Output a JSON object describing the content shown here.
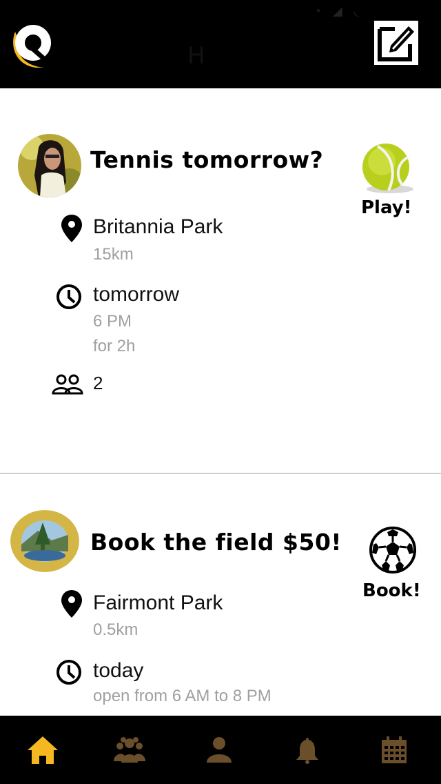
{
  "header": {
    "title": "H",
    "logo_icon": "app-logo-icon",
    "compose_icon": "compose-icon"
  },
  "colors": {
    "header_bg": "#000000",
    "accent": "#f5b820",
    "tab_inactive": "#6b4f2a",
    "secondary_text": "#a0a0a0"
  },
  "cards": [
    {
      "title": "Tennis tomorrow?",
      "action_label": "Play!",
      "action_icon": "tennis-ball-icon",
      "location": "Britannia Park",
      "distance": "15km",
      "day": "tomorrow",
      "time": "6 PM",
      "duration": "for 2h",
      "participants": "2"
    },
    {
      "title": "Book the field $50!",
      "action_label": "Book!",
      "action_icon": "soccer-ball-icon",
      "location": "Fairmont Park",
      "distance": "0.5km",
      "day": "today",
      "hours": "open from 6 AM to 8 PM"
    }
  ],
  "tabbar": {
    "items": [
      {
        "icon": "home-icon",
        "active": true
      },
      {
        "icon": "group-icon",
        "active": false
      },
      {
        "icon": "profile-icon",
        "active": false
      },
      {
        "icon": "bell-icon",
        "active": false
      },
      {
        "icon": "calendar-icon",
        "active": false
      }
    ]
  }
}
